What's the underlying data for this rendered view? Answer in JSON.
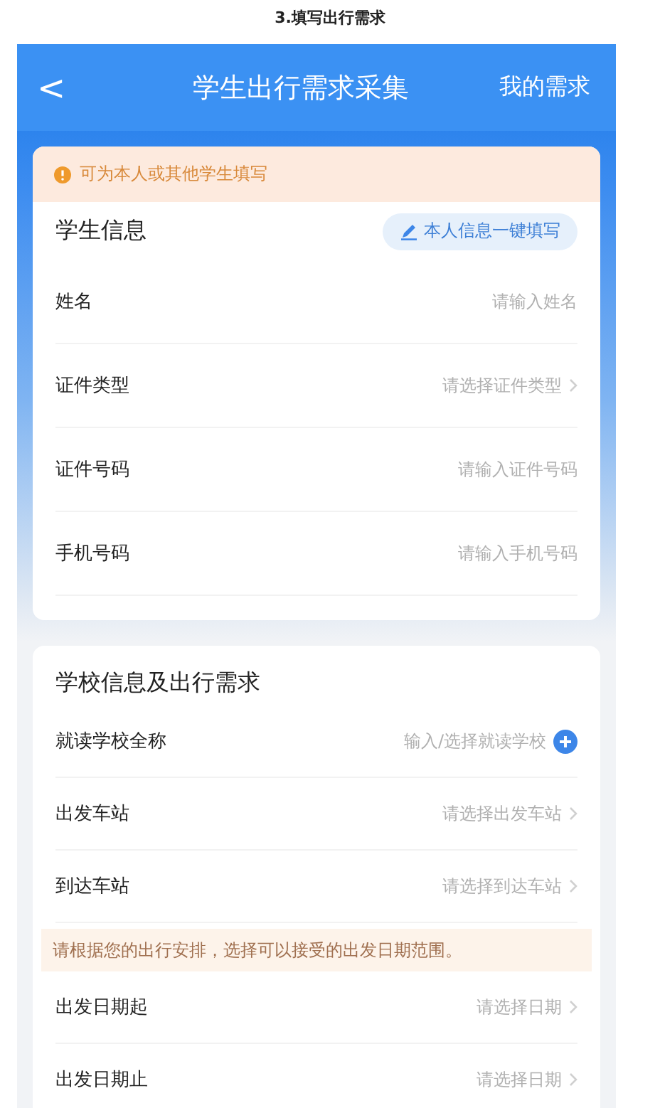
{
  "caption": "3.填写出行需求",
  "header": {
    "back": "<",
    "title": "学生出行需求采集",
    "action": "我的需求"
  },
  "notice": "可为本人或其他学生填写",
  "student": {
    "title": "学生信息",
    "autofill": "本人信息一键填写",
    "fields": [
      {
        "label": "姓名",
        "placeholder": "请输入姓名",
        "kind": "input"
      },
      {
        "label": "证件类型",
        "placeholder": "请选择证件类型",
        "kind": "select"
      },
      {
        "label": "证件号码",
        "placeholder": "请输入证件号码",
        "kind": "input"
      },
      {
        "label": "手机号码",
        "placeholder": "请输入手机号码",
        "kind": "input"
      }
    ]
  },
  "school": {
    "title": "学校信息及出行需求",
    "fields": [
      {
        "label": "就读学校全称",
        "placeholder": "输入/选择就读学校",
        "kind": "add"
      },
      {
        "label": "出发车站",
        "placeholder": "请选择出发车站",
        "kind": "select"
      },
      {
        "label": "到达车站",
        "placeholder": "请选择到达车站",
        "kind": "select"
      },
      {
        "kind": "hint",
        "text": "请根据您的出行安排，选择可以接受的出发日期范围。"
      },
      {
        "label": "出发日期起",
        "placeholder": "请选择日期",
        "kind": "select"
      },
      {
        "label": "出发日期止",
        "placeholder": "请选择日期",
        "kind": "select"
      }
    ]
  }
}
